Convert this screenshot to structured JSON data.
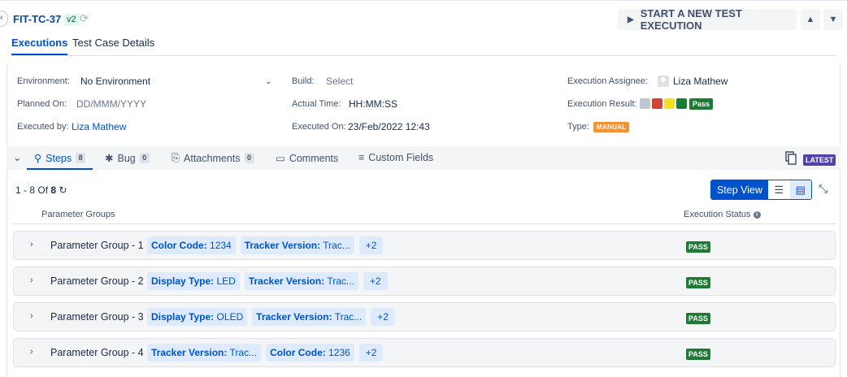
{
  "header": {
    "test_case_key": "FIT-TC-37",
    "version": "v2",
    "start_button_label": "START A NEW TEST EXECUTION"
  },
  "tabs": [
    {
      "label": "Executions",
      "active": true
    },
    {
      "label": "Test Case Details",
      "active": false
    }
  ],
  "details": {
    "environment_label": "Environment:",
    "environment_value": "No Environment",
    "build_label": "Build:",
    "build_value": "Select",
    "assignee_label": "Execution Assignee:",
    "assignee_value": "Liza Mathew",
    "planned_on_label": "Planned On:",
    "planned_on_value": "DD/MMM/YYYY",
    "actual_time_label": "Actual Time:",
    "actual_time_value": "HH:MM:SS",
    "result_label": "Execution Result:",
    "result_value": "Pass",
    "result_swatches": [
      "#c1c7d0",
      "#d04437",
      "#f6e120",
      "#1e7a34"
    ],
    "executed_by_label": "Executed by:",
    "executed_by_value": "Liza Mathew",
    "executed_on_label": "Executed On:",
    "executed_on_value": "23/Feb/2022 12:43",
    "type_label": "Type:",
    "type_value": "MANUAL"
  },
  "subtabs": [
    {
      "label": "Steps",
      "count": "8",
      "icon": "steps-icon",
      "active": true
    },
    {
      "label": "Bug",
      "count": "0",
      "icon": "bug-icon",
      "active": false
    },
    {
      "label": "Attachments",
      "count": "0",
      "icon": "paperclip-icon",
      "active": false
    },
    {
      "label": "Comments",
      "icon": "comment-icon",
      "active": false
    },
    {
      "label": "Custom Fields",
      "icon": "custom-fields-icon",
      "active": false
    }
  ],
  "latest_badge": "LATEST",
  "pagination": {
    "range": "1 - 8",
    "of": "Of",
    "total": "8"
  },
  "step_view_label": "Step View",
  "table": {
    "col_parameter_groups": "Parameter Groups",
    "col_execution_status": "Execution Status"
  },
  "groups": [
    {
      "title": "Parameter Group - 1",
      "chips": [
        {
          "key": "Color Code:",
          "val": "1234"
        },
        {
          "key": "Tracker Version:",
          "val": "Trac..."
        }
      ],
      "more": "+2",
      "status": "PASS"
    },
    {
      "title": "Parameter Group - 2",
      "chips": [
        {
          "key": "Display Type:",
          "val": "LED"
        },
        {
          "key": "Tracker Version:",
          "val": "Trac..."
        }
      ],
      "more": "+2",
      "status": "PASS"
    },
    {
      "title": "Parameter Group - 3",
      "chips": [
        {
          "key": "Display Type:",
          "val": "OLED"
        },
        {
          "key": "Tracker Version:",
          "val": "Trac..."
        }
      ],
      "more": "+2",
      "status": "PASS"
    },
    {
      "title": "Parameter Group - 4",
      "chips": [
        {
          "key": "Tracker Version:",
          "val": "Trac..."
        },
        {
          "key": "Color Code:",
          "val": "1236"
        }
      ],
      "more": "+2",
      "status": "PASS"
    }
  ]
}
